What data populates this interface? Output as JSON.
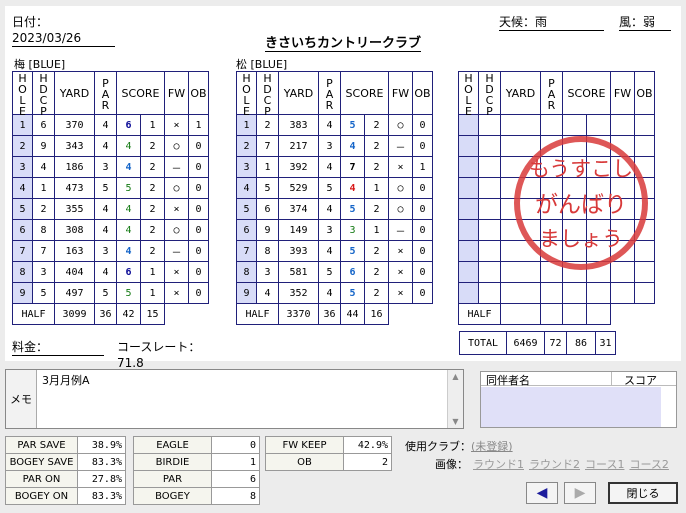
{
  "header": {
    "date": "日付：2023/03/26",
    "weather": "天候：雨",
    "wind": "風：弱",
    "club": "きさいちカントリークラブ"
  },
  "courses": [
    {
      "name": "梅 [BLUE]",
      "half": {
        "label": "HALF",
        "yard": "3099",
        "par": "36",
        "score": "42",
        "putt": "15"
      },
      "holes": [
        {
          "hole": "1",
          "hdcp": "6",
          "yard": "370",
          "par": "4",
          "score": "6",
          "putt": "1",
          "fw": "×",
          "ob": "1",
          "cls": "navy"
        },
        {
          "hole": "2",
          "hdcp": "9",
          "yard": "343",
          "par": "4",
          "score": "4",
          "putt": "2",
          "fw": "○",
          "ob": "0",
          "cls": "green"
        },
        {
          "hole": "3",
          "hdcp": "4",
          "yard": "186",
          "par": "3",
          "score": "4",
          "putt": "2",
          "fw": "－",
          "ob": "0",
          "cls": "blue"
        },
        {
          "hole": "4",
          "hdcp": "1",
          "yard": "473",
          "par": "5",
          "score": "5",
          "putt": "2",
          "fw": "○",
          "ob": "0",
          "cls": "green"
        },
        {
          "hole": "5",
          "hdcp": "2",
          "yard": "355",
          "par": "4",
          "score": "4",
          "putt": "2",
          "fw": "×",
          "ob": "0",
          "cls": "green"
        },
        {
          "hole": "6",
          "hdcp": "8",
          "yard": "308",
          "par": "4",
          "score": "4",
          "putt": "2",
          "fw": "○",
          "ob": "0",
          "cls": "green"
        },
        {
          "hole": "7",
          "hdcp": "7",
          "yard": "163",
          "par": "3",
          "score": "4",
          "putt": "2",
          "fw": "－",
          "ob": "0",
          "cls": "blue"
        },
        {
          "hole": "8",
          "hdcp": "3",
          "yard": "404",
          "par": "4",
          "score": "6",
          "putt": "1",
          "fw": "×",
          "ob": "0",
          "cls": "navy"
        },
        {
          "hole": "9",
          "hdcp": "5",
          "yard": "497",
          "par": "5",
          "score": "5",
          "putt": "1",
          "fw": "×",
          "ob": "0",
          "cls": "green"
        }
      ]
    },
    {
      "name": "松 [BLUE]",
      "half": {
        "label": "HALF",
        "yard": "3370",
        "par": "36",
        "score": "44",
        "putt": "16"
      },
      "holes": [
        {
          "hole": "1",
          "hdcp": "2",
          "yard": "383",
          "par": "4",
          "score": "5",
          "putt": "2",
          "fw": "○",
          "ob": "0",
          "cls": "blue"
        },
        {
          "hole": "2",
          "hdcp": "7",
          "yard": "217",
          "par": "3",
          "score": "4",
          "putt": "2",
          "fw": "－",
          "ob": "0",
          "cls": "blue"
        },
        {
          "hole": "3",
          "hdcp": "1",
          "yard": "392",
          "par": "4",
          "score": "7",
          "putt": "2",
          "fw": "×",
          "ob": "1",
          "cls": "blk"
        },
        {
          "hole": "4",
          "hdcp": "5",
          "yard": "529",
          "par": "5",
          "score": "4",
          "putt": "1",
          "fw": "○",
          "ob": "0",
          "cls": "red"
        },
        {
          "hole": "5",
          "hdcp": "6",
          "yard": "374",
          "par": "4",
          "score": "5",
          "putt": "2",
          "fw": "○",
          "ob": "0",
          "cls": "blue"
        },
        {
          "hole": "6",
          "hdcp": "9",
          "yard": "149",
          "par": "3",
          "score": "3",
          "putt": "1",
          "fw": "－",
          "ob": "0",
          "cls": "green"
        },
        {
          "hole": "7",
          "hdcp": "8",
          "yard": "393",
          "par": "4",
          "score": "5",
          "putt": "2",
          "fw": "×",
          "ob": "0",
          "cls": "blue"
        },
        {
          "hole": "8",
          "hdcp": "3",
          "yard": "581",
          "par": "5",
          "score": "6",
          "putt": "2",
          "fw": "×",
          "ob": "0",
          "cls": "blue"
        },
        {
          "hole": "9",
          "hdcp": "4",
          "yard": "352",
          "par": "4",
          "score": "5",
          "putt": "2",
          "fw": "×",
          "ob": "0",
          "cls": "blue"
        }
      ]
    },
    {
      "name": "",
      "half": {
        "label": "HALF",
        "yard": "",
        "par": "",
        "score": "",
        "putt": ""
      },
      "holes": []
    }
  ],
  "columns": {
    "hole": "HOLE",
    "hdcp": "HDCP",
    "yard": "YARD",
    "par": "PAR",
    "score": "SCORE",
    "fw": "FW",
    "ob": "OB"
  },
  "total": {
    "label": "TOTAL",
    "yard": "6469",
    "par": "72",
    "score": "86",
    "putt": "31"
  },
  "fee": "料金：",
  "course_rate": "コースレート：  71.8",
  "stamp": {
    "line1": "もうすこし",
    "line2": "がんばり",
    "line3": "ましょう",
    "color": "#d83a3a"
  },
  "memo": {
    "label": "メモ",
    "text": "3月月例A"
  },
  "companions": {
    "col1": "同伴者名",
    "col2": "スコア"
  },
  "stats1": [
    {
      "k": "PAR SAVE",
      "v": "38.9%"
    },
    {
      "k": "BOGEY SAVE",
      "v": "83.3%"
    },
    {
      "k": "PAR ON",
      "v": "27.8%"
    },
    {
      "k": "BOGEY ON",
      "v": "83.3%"
    }
  ],
  "stats2": [
    {
      "k": "EAGLE",
      "v": "0"
    },
    {
      "k": "BIRDIE",
      "v": "1"
    },
    {
      "k": "PAR",
      "v": "6"
    },
    {
      "k": "BOGEY",
      "v": "8"
    }
  ],
  "stats3": [
    {
      "k": "FW KEEP",
      "v": "42.9%"
    },
    {
      "k": "OB",
      "v": "2"
    }
  ],
  "used_club": {
    "label": "使用クラブ：",
    "link": "(未登録)"
  },
  "pictures": {
    "label": "画像：",
    "links": [
      "ラウンド1",
      "ラウンド2",
      "コース1",
      "コース2"
    ]
  },
  "buttons": {
    "prev": "◀",
    "next": "▶",
    "close": "閉じる"
  }
}
